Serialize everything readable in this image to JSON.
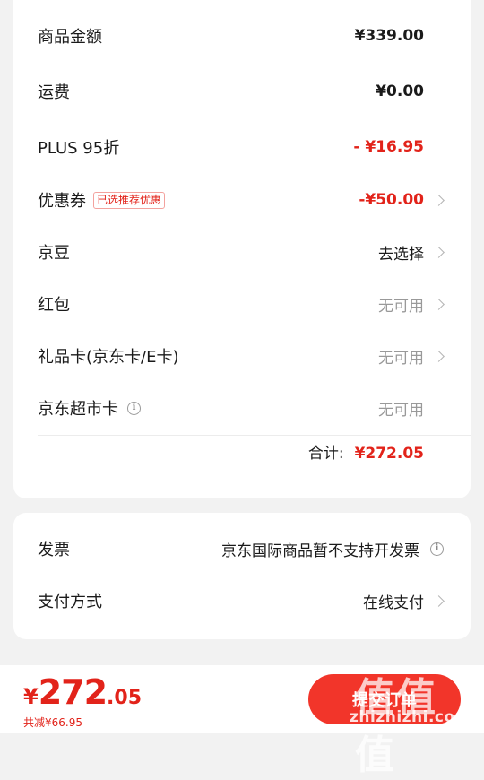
{
  "summary": {
    "rows": [
      {
        "label": "商品金额",
        "value": "¥339.00"
      },
      {
        "label": "运费",
        "value": "¥0.00"
      },
      {
        "label": "PLUS 95折",
        "value": "- ¥16.95"
      },
      {
        "label": "优惠券",
        "tag": "已选推荐优惠",
        "value": "-¥50.00"
      },
      {
        "label": "京豆",
        "value": "去选择"
      },
      {
        "label": "红包",
        "value": "无可用"
      },
      {
        "label": "礼品卡(京东卡/E卡)",
        "value": "无可用"
      },
      {
        "label": "京东超市卡",
        "value": "无可用"
      }
    ],
    "total_label": "合计:",
    "total_value": "¥272.05"
  },
  "extra": {
    "invoice_label": "发票",
    "invoice_value": "京东国际商品暂不支持开发票",
    "payment_label": "支付方式",
    "payment_value": "在线支付"
  },
  "footer": {
    "currency": "¥",
    "price_int": "272",
    "price_dec": ".05",
    "saved": "共减¥66.95",
    "submit_label": "提交订单"
  },
  "watermark": {
    "glyphs": "值值值",
    "url": "zhizhizhi.com"
  },
  "colors": {
    "accent": "#e2231a",
    "button": "#f2352a",
    "background": "#f2f2f2"
  }
}
